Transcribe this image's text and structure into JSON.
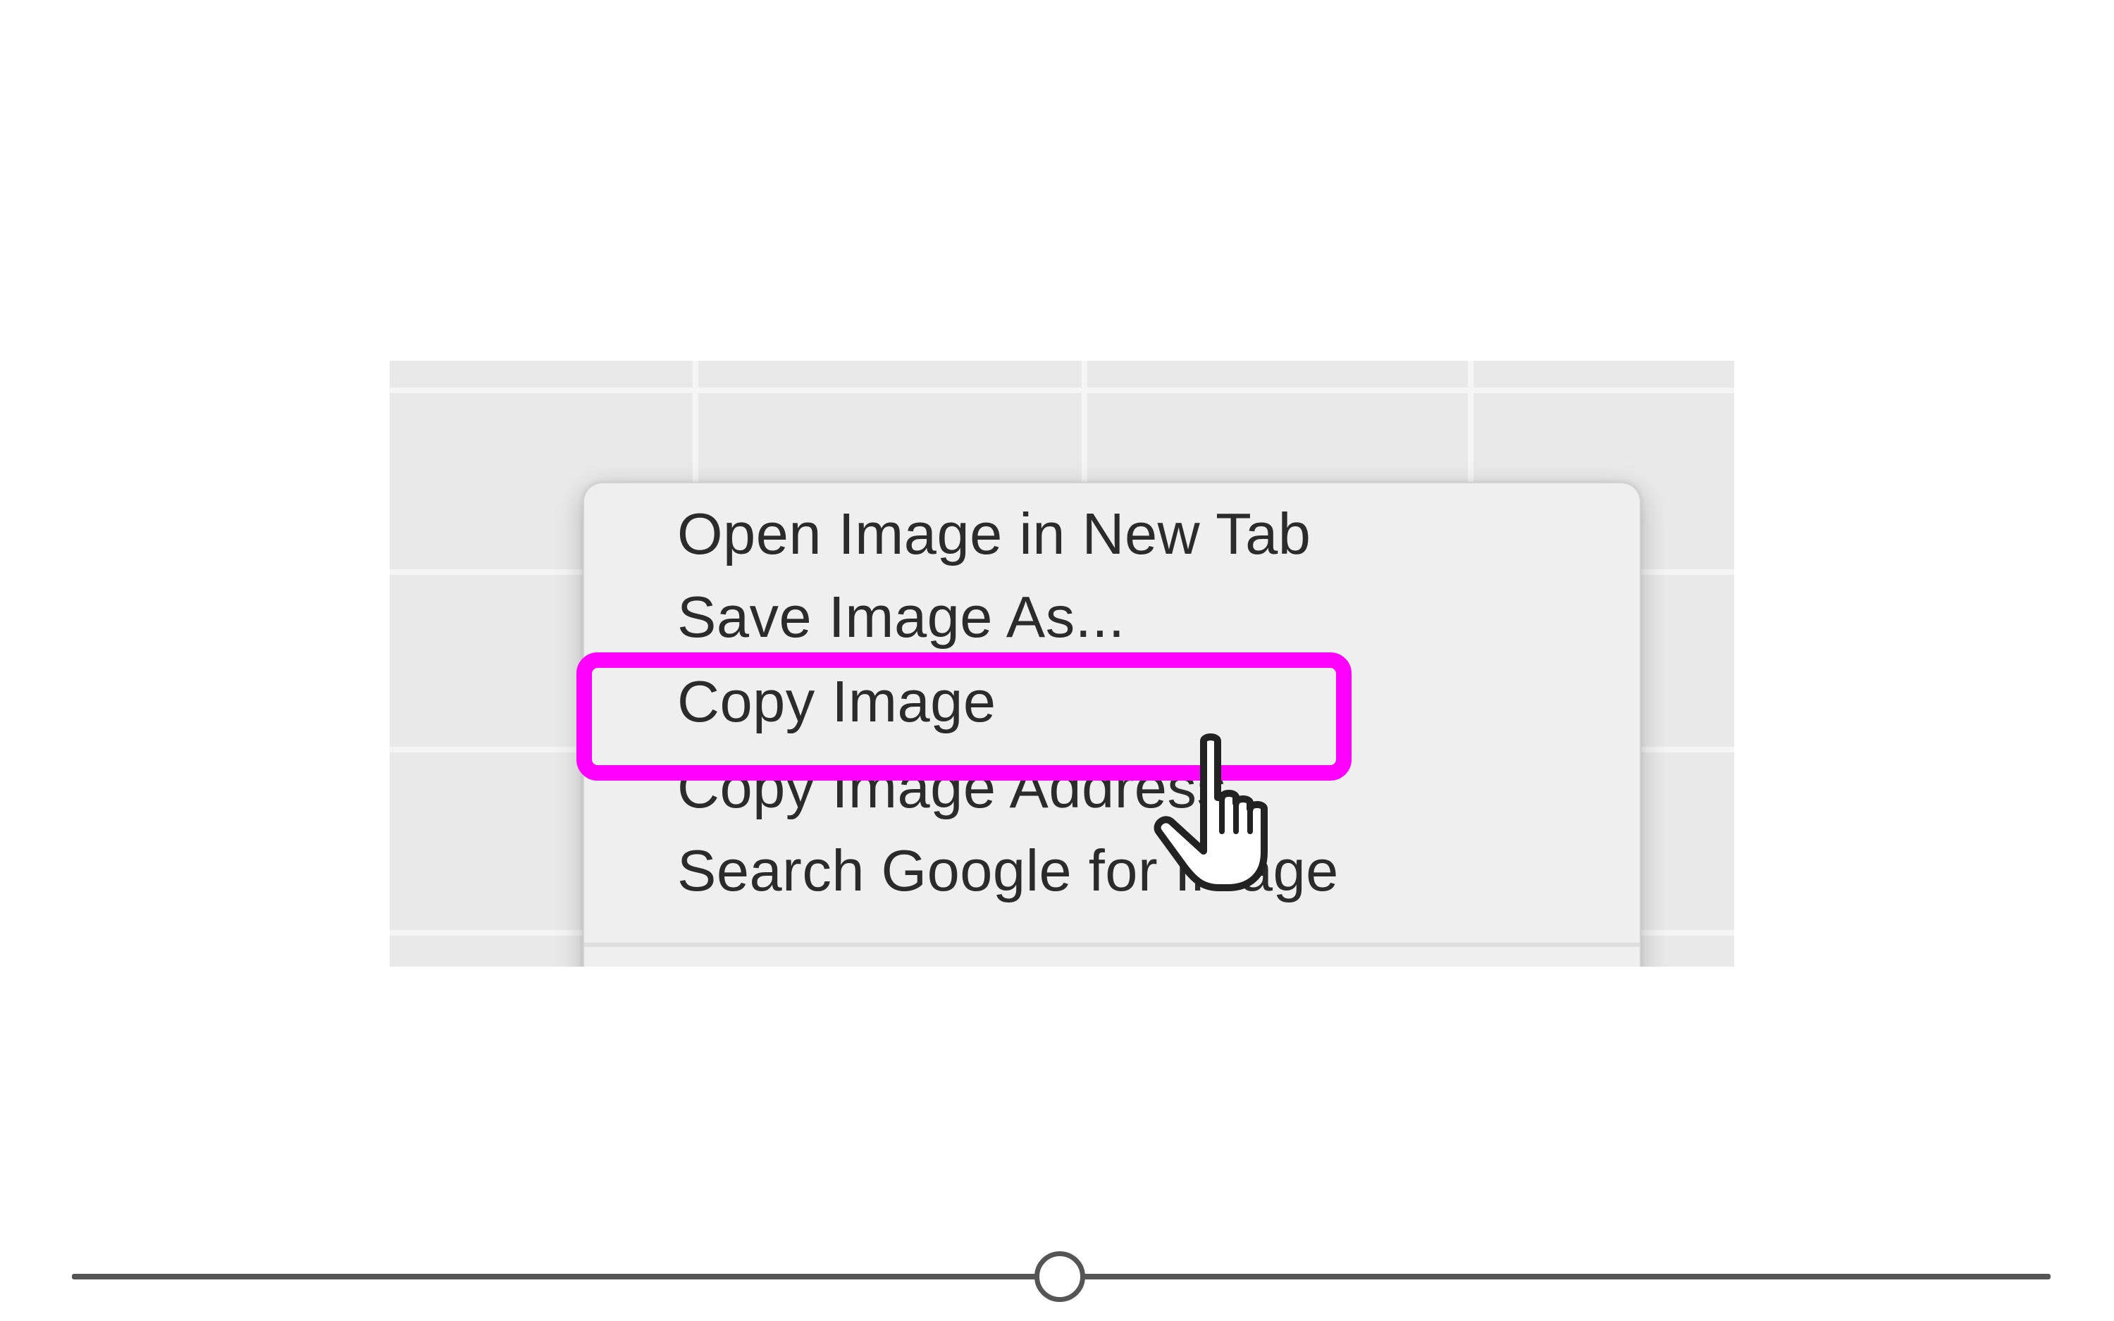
{
  "context_menu": {
    "items": [
      {
        "label": "Open Image in New Tab"
      },
      {
        "label": "Save Image As..."
      },
      {
        "label": "Copy Image"
      },
      {
        "label": "Copy Image Address"
      },
      {
        "label": "Search Google for Image"
      }
    ],
    "highlighted_item": "Copy Image"
  },
  "highlight": {
    "color": "#ff00ff"
  },
  "cursor": {
    "icon": "hand-pointer-icon"
  },
  "timeline": {
    "position": 0.5
  }
}
